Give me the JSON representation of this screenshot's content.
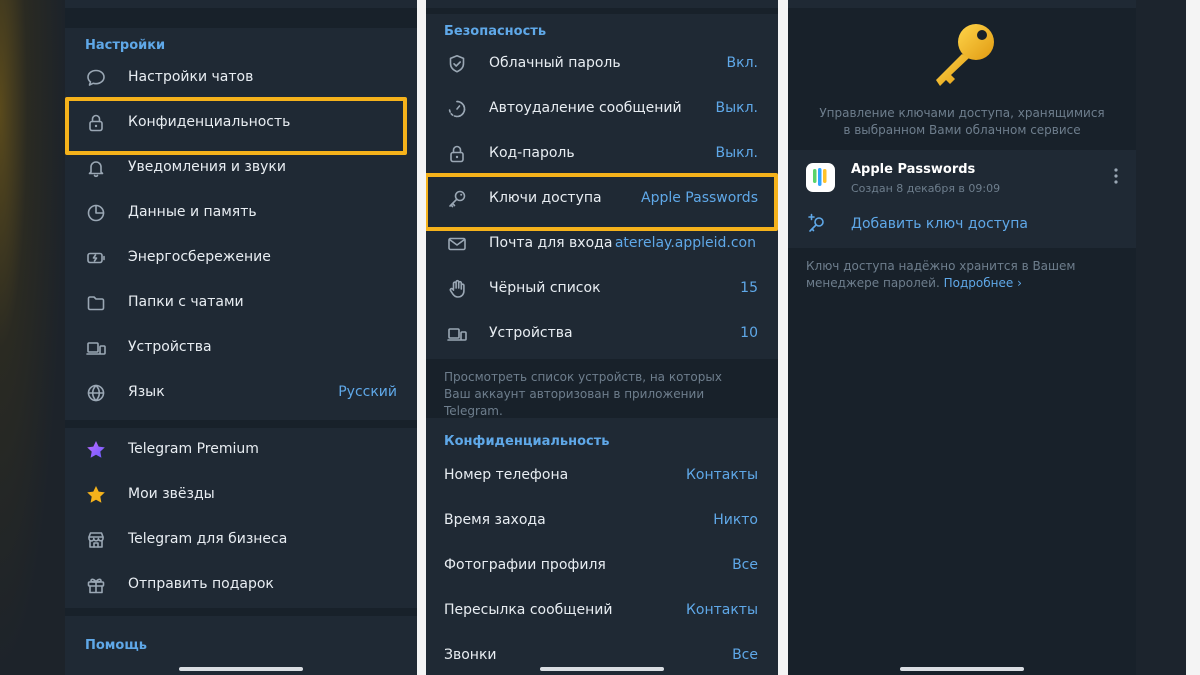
{
  "screen1": {
    "settings_header": "Настройки",
    "items": [
      {
        "label": "Настройки чатов",
        "icon": "chat-bubble-icon"
      },
      {
        "label": "Конфиденциальность",
        "icon": "lock-icon"
      },
      {
        "label": "Уведомления и звуки",
        "icon": "bell-icon"
      },
      {
        "label": "Данные и память",
        "icon": "pie-chart-icon"
      },
      {
        "label": "Энергосбережение",
        "icon": "battery-icon"
      },
      {
        "label": "Папки с чатами",
        "icon": "folder-icon"
      },
      {
        "label": "Устройства",
        "icon": "devices-icon"
      },
      {
        "label": "Язык",
        "value": "Русский",
        "icon": "globe-icon"
      }
    ],
    "premium_items": [
      {
        "label": "Telegram Premium",
        "icon": "purple-star-icon"
      },
      {
        "label": "Мои звёзды",
        "icon": "gold-star-icon"
      },
      {
        "label": "Telegram для бизнеса",
        "icon": "store-icon"
      },
      {
        "label": "Отправить подарок",
        "icon": "gift-icon"
      }
    ],
    "help_header": "Помощь"
  },
  "screen2": {
    "security_header": "Безопасность",
    "security_items": [
      {
        "label": "Облачный пароль",
        "value": "Вкл.",
        "icon": "shield-check-icon"
      },
      {
        "label": "Автоудаление сообщений",
        "value": "Выкл.",
        "icon": "timer-icon"
      },
      {
        "label": "Код-пароль",
        "value": "Выкл.",
        "icon": "lock-icon"
      },
      {
        "label": "Ключи доступа",
        "value": "Apple Passwords",
        "icon": "key-icon"
      },
      {
        "label": "Почта для входа",
        "value": "aterelay.appleid.con",
        "icon": "envelope-icon"
      },
      {
        "label": "Чёрный список",
        "value": "15",
        "icon": "hand-icon"
      },
      {
        "label": "Устройства",
        "value": "10",
        "icon": "devices-icon"
      }
    ],
    "devices_note": "Просмотреть список устройств, на которых Ваш аккаунт авторизован в приложении Telegram.",
    "privacy_header": "Конфиденциальность",
    "privacy_items": [
      {
        "label": "Номер телефона",
        "value": "Контакты"
      },
      {
        "label": "Время захода",
        "value": "Никто"
      },
      {
        "label": "Фотографии профиля",
        "value": "Все"
      },
      {
        "label": "Пересылка сообщений",
        "value": "Контакты"
      },
      {
        "label": "Звонки",
        "value": "Все"
      }
    ]
  },
  "screen3": {
    "header_icon": "golden-key-icon",
    "description": "Управление ключами доступа, хранящимися в выбранном Вами облачном сервисе",
    "passkey": {
      "name": "Apple Passwords",
      "created": "Создан 8 декабря в 09:09",
      "icon": "apple-passwords-app-icon"
    },
    "add_label": "Добавить ключ доступа",
    "footer_note": "Ключ доступа надёжно хранится в Вашем менеджере паролей.",
    "more_link": "Подробнее ›"
  },
  "colors": {
    "accent": "#5fa8e8",
    "highlight": "#f5b21b",
    "background": "#18212a",
    "section": "#1f2934"
  }
}
